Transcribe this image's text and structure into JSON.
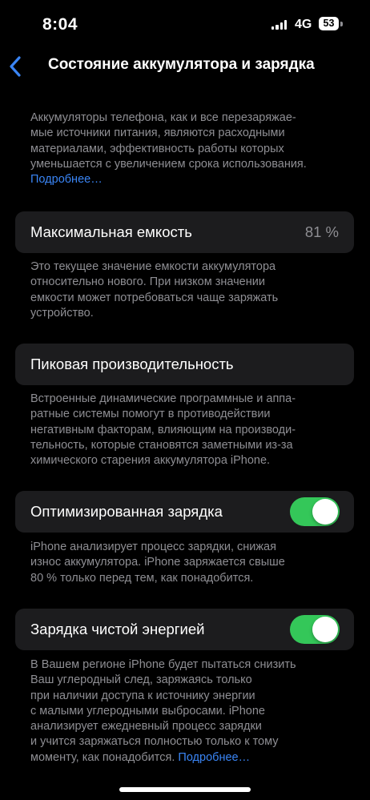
{
  "status_bar": {
    "time": "8:04",
    "network": "4G",
    "battery_level": "53",
    "signal_icon": "cellular-signal-icon"
  },
  "nav": {
    "back_icon": "chevron-left-icon",
    "title": "Состояние аккумулятора и зарядка"
  },
  "intro": {
    "text": "Аккумуляторы телефона, как и все перезаряжае-\nмые источники питания, являются расходными\nматериалами, эффективность работы которых\nуменьшается с увеличением срока использования.",
    "link": "Подробнее…"
  },
  "max_capacity": {
    "label": "Максимальная емкость",
    "value": "81 %",
    "description": "Это текущее значение емкости аккумулятора\nотносительно нового. При низком значении\nемкости может потребоваться чаще заряжать\nустройство."
  },
  "peak_performance": {
    "label": "Пиковая производительность",
    "description": "Встроенные динамические программные и аппа-\nратные системы помогут в противодействии\nнегативным факторам, влияющим на производи-\nтельность, которые становятся заметными из-за\nхимического старения аккумулятора iPhone."
  },
  "optimized_charging": {
    "label": "Оптимизированная зарядка",
    "enabled": true,
    "description": "iPhone анализирует процесс зарядки, снижая\nизнос аккумулятора. iPhone заряжается свыше\n80 % только перед тем, как понадобится."
  },
  "clean_energy": {
    "label": "Зарядка чистой энергией",
    "enabled": true,
    "description": "В Вашем регионе iPhone будет пытаться снизить\nВаш углеродный след, заряжаясь только\nпри наличии доступа к источнику энергии\nс малыми углеродными выбросами. iPhone\nанализирует ежедневный процесс зарядки\nи учится заряжаться полностью только к тому\nмоменту, как понадобится. ",
    "link": "Подробнее…"
  },
  "colors": {
    "background": "#000000",
    "cell": "#1c1c1e",
    "secondary_text": "#8e8e93",
    "accent": "#3a85f5",
    "toggle_on": "#34c759"
  }
}
